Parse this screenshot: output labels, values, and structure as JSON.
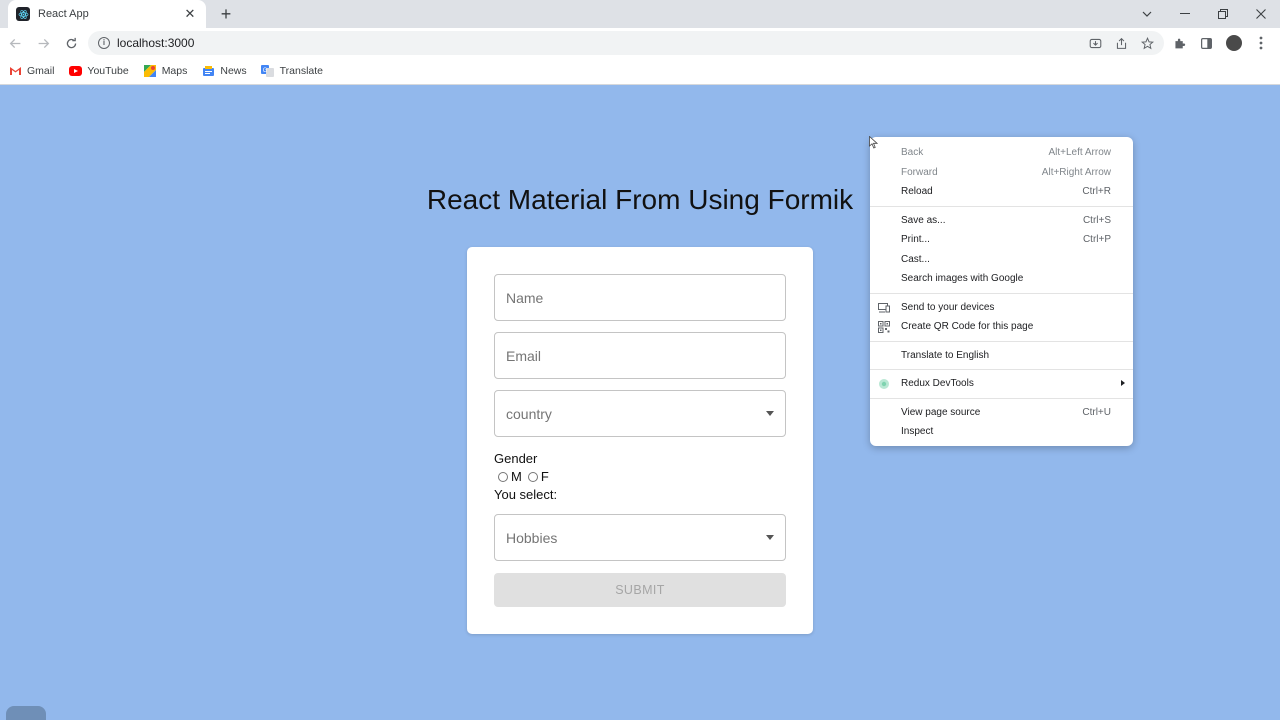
{
  "browser": {
    "tab_title": "React App",
    "url": "localhost:3000",
    "bookmarks": [
      {
        "label": "Gmail",
        "icon": "gmail-icon"
      },
      {
        "label": "YouTube",
        "icon": "youtube-icon"
      },
      {
        "label": "Maps",
        "icon": "maps-icon"
      },
      {
        "label": "News",
        "icon": "news-icon"
      },
      {
        "label": "Translate",
        "icon": "translate-icon"
      }
    ]
  },
  "page": {
    "title": "React Material From Using Formik",
    "name_placeholder": "Name",
    "email_placeholder": "Email",
    "country_placeholder": "country",
    "gender_label": "Gender",
    "gender_options": [
      "M",
      "F"
    ],
    "you_select_label": "You select:",
    "hobbies_placeholder": "Hobbies",
    "submit_label": "SUBMIT"
  },
  "context_menu": {
    "back": {
      "label": "Back",
      "shortcut": "Alt+Left Arrow"
    },
    "forward": {
      "label": "Forward",
      "shortcut": "Alt+Right Arrow"
    },
    "reload": {
      "label": "Reload",
      "shortcut": "Ctrl+R"
    },
    "save_as": {
      "label": "Save as...",
      "shortcut": "Ctrl+S"
    },
    "print": {
      "label": "Print...",
      "shortcut": "Ctrl+P"
    },
    "cast": {
      "label": "Cast..."
    },
    "search_images": {
      "label": "Search images with Google"
    },
    "send_devices": {
      "label": "Send to your devices"
    },
    "qr_code": {
      "label": "Create QR Code for this page"
    },
    "translate": {
      "label": "Translate to English"
    },
    "redux": {
      "label": "Redux DevTools"
    },
    "view_source": {
      "label": "View page source",
      "shortcut": "Ctrl+U"
    },
    "inspect": {
      "label": "Inspect"
    }
  },
  "colors": {
    "page_background": "#92b8ec",
    "card_background": "#ffffff",
    "submit_disabled": "#e0e0e0"
  }
}
